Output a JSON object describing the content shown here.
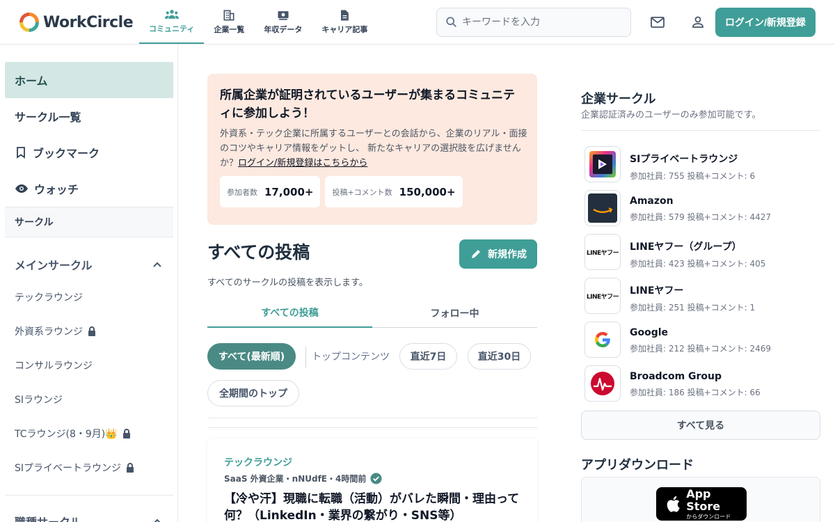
{
  "header": {
    "logo_text": "WorkCircle",
    "nav": [
      {
        "label": "コミュニティ",
        "icon": "community-icon"
      },
      {
        "label": "企業一覧",
        "icon": "building-icon"
      },
      {
        "label": "年収データ",
        "icon": "money-icon"
      },
      {
        "label": "キャリア記事",
        "icon": "document-icon"
      }
    ],
    "search_placeholder": "キーワードを入力",
    "login_label": "ログイン/新規登録"
  },
  "sidebar": {
    "items": [
      {
        "label": "ホーム"
      },
      {
        "label": "サークル一覧"
      },
      {
        "label": "ブックマーク",
        "icon": "bookmark-icon"
      },
      {
        "label": "ウォッチ",
        "icon": "eye-icon"
      }
    ],
    "section_label": "サークル",
    "group_label": "メインサークル",
    "lounges": [
      {
        "label": "テックラウンジ"
      },
      {
        "label": "外資系ラウンジ",
        "locked": true
      },
      {
        "label": "コンサルラウンジ"
      },
      {
        "label": "SIラウンジ"
      },
      {
        "label": "TCラウンジ(8・9月)👑",
        "locked": true
      },
      {
        "label": "SIプライベートラウンジ",
        "locked": true
      }
    ],
    "group2_label": "職種サークル"
  },
  "banner": {
    "title": "所属企業が証明されているユーザーが集まるコミュニティに参加しよう！",
    "text": "外資系・テック企業に所属するユーザーとの会話から、企業のリアル・面接のコツやキャリア情報をゲットし、 新たなキャリアの選択肢を広げませんか？",
    "link": "ログイン/新規登録はこちらから",
    "stats": [
      {
        "label": "参加者数",
        "value": "17,000+"
      },
      {
        "label": "投稿+コメント数",
        "value": "150,000+"
      }
    ]
  },
  "posts": {
    "title": "すべての投稿",
    "new_button": "新規作成",
    "subtitle": "すべてのサークルの投稿を表示します。",
    "tabs": [
      "すべての投稿",
      "フォロー中"
    ],
    "filters": {
      "latest": "すべて(最新順)",
      "top": "トップコンテンツ",
      "d7": "直近7日",
      "d30": "直近30日",
      "all_time": "全期間のトップ"
    },
    "card": {
      "lounge": "テックラウンジ",
      "meta": "SaaS 外資企業・nNUdfE・",
      "time": "4時間前",
      "title": "【冷や汗】現職に転職（活動）がバレた瞬間・理由って何？（LinkedIn・業界の繋がり・SNS等）"
    }
  },
  "right": {
    "title": "企業サークル",
    "subtitle": "企業認証済みのユーザーのみ参加可能です。",
    "companies": [
      {
        "name": "SIプライベートラウンジ",
        "stats": "参加社員: 755 投稿+コメント: 6"
      },
      {
        "name": "Amazon",
        "stats": "参加社員: 579 投稿+コメント: 4427"
      },
      {
        "name": "LINEヤフー（グループ）",
        "stats": "参加社員: 423 投稿+コメント: 405",
        "logo_text": "LINEヤフー"
      },
      {
        "name": "LINEヤフー",
        "stats": "参加社員: 251 投稿+コメント: 1",
        "logo_text": "LINEヤフー"
      },
      {
        "name": "Google",
        "stats": "参加社員: 212 投稿+コメント: 2469"
      },
      {
        "name": "Broadcom Group",
        "stats": "参加社員: 186 投稿+コメント: 66"
      }
    ],
    "see_all": "すべて見る",
    "app_title": "アプリダウンロード",
    "appstore_big": "App Store",
    "appstore_small": "からダウンロード"
  },
  "colors": {
    "accent": "#3f9e97",
    "banner_bg": "#fde9df",
    "active_side": "#d3e7e5"
  }
}
